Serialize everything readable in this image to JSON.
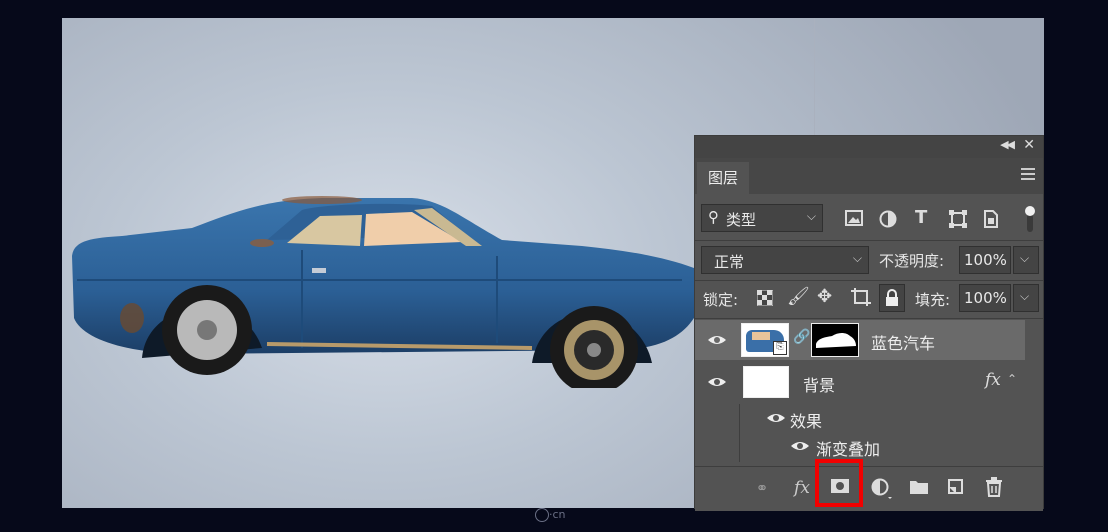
{
  "panel": {
    "tab_label": "图层",
    "filter_kind": "类型",
    "blend_mode": "正常",
    "opacity_label": "不透明度:",
    "opacity_value": "100%",
    "lock_label": "锁定:",
    "fill_label": "填充:",
    "fill_value": "100%",
    "layers": [
      {
        "name": "蓝色汽车",
        "selected": true
      },
      {
        "name": "背景",
        "fx": "fx"
      }
    ],
    "effects_label": "效果",
    "gradient_overlay_label": "渐变叠加"
  },
  "bottom_bar": {
    "fx_label": "fx"
  },
  "watermark": "·cn",
  "colors": {
    "panel_bg": "#535353",
    "highlight": "#f20000",
    "car_blue": "#2f5f8f"
  }
}
